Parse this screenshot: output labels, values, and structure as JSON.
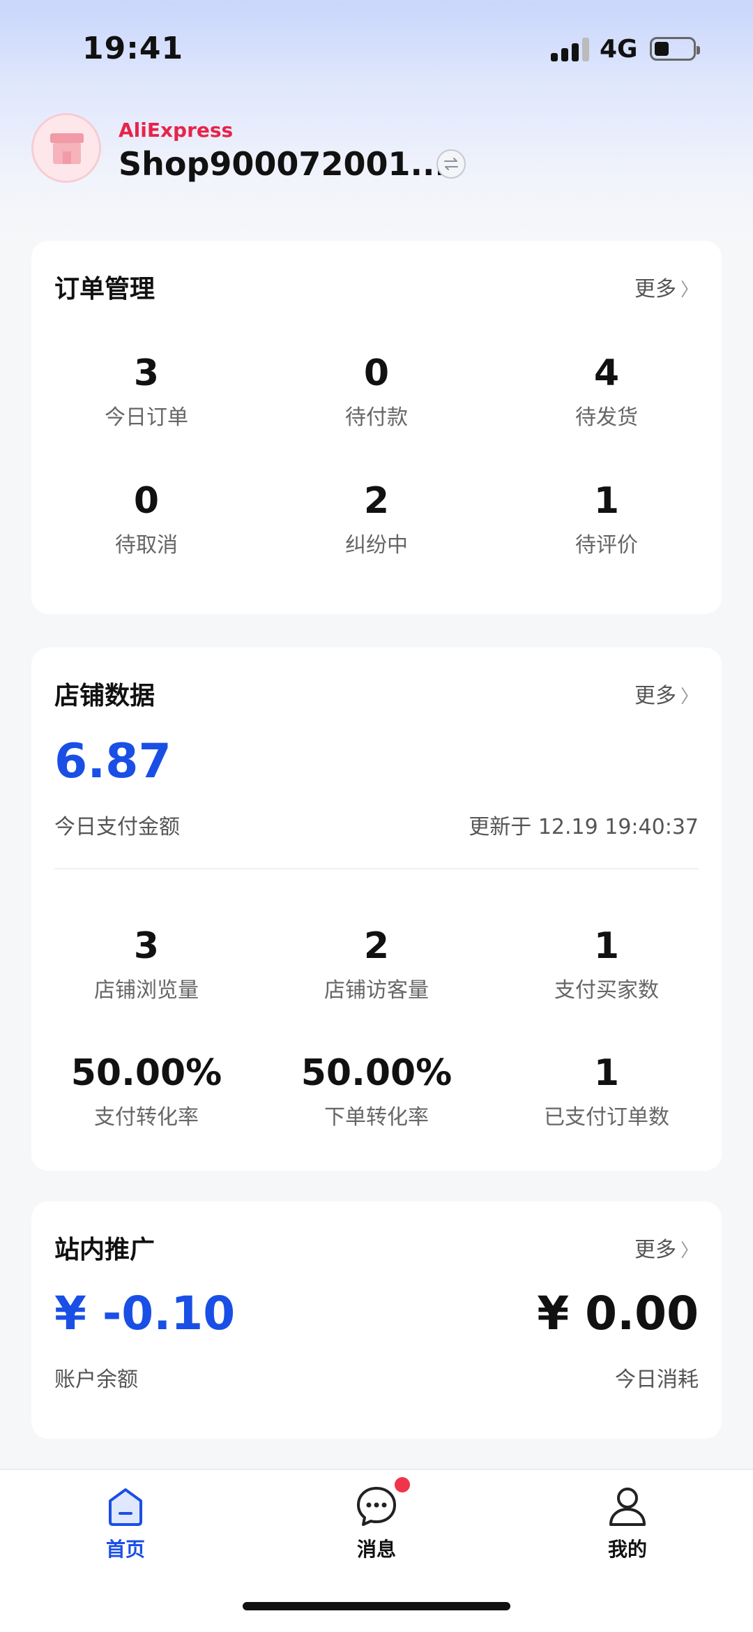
{
  "status_bar": {
    "time": "19:41",
    "network": "4G"
  },
  "shop": {
    "brand": "AliExpress",
    "name": "Shop900072001..."
  },
  "order_management": {
    "title": "订单管理",
    "more": "更多",
    "items": [
      {
        "value": "3",
        "label": "今日订单"
      },
      {
        "value": "0",
        "label": "待付款"
      },
      {
        "value": "4",
        "label": "待发货"
      },
      {
        "value": "0",
        "label": "待取消"
      },
      {
        "value": "2",
        "label": "纠纷中"
      },
      {
        "value": "1",
        "label": "待评价"
      }
    ]
  },
  "store_data": {
    "title": "店铺数据",
    "more": "更多",
    "amount": "6.87",
    "amount_label": "今日支付金额",
    "updated": "更新于 12.19 19:40:37",
    "items": [
      {
        "value": "3",
        "label": "店铺浏览量"
      },
      {
        "value": "2",
        "label": "店铺访客量"
      },
      {
        "value": "1",
        "label": "支付买家数"
      },
      {
        "value": "50.00%",
        "label": "支付转化率"
      },
      {
        "value": "50.00%",
        "label": "下单转化率"
      },
      {
        "value": "1",
        "label": "已支付订单数"
      }
    ]
  },
  "promotion": {
    "title": "站内推广",
    "more": "更多",
    "balance": "¥ -0.10",
    "balance_label": "账户余额",
    "spend": "¥ 0.00",
    "spend_label": "今日消耗"
  },
  "bottom_nav": {
    "home": "首页",
    "messages": "消息",
    "mine": "我的"
  },
  "colors": {
    "accent": "#1a4fe6",
    "badge": "#f0354a",
    "brand": "#e8234a"
  }
}
